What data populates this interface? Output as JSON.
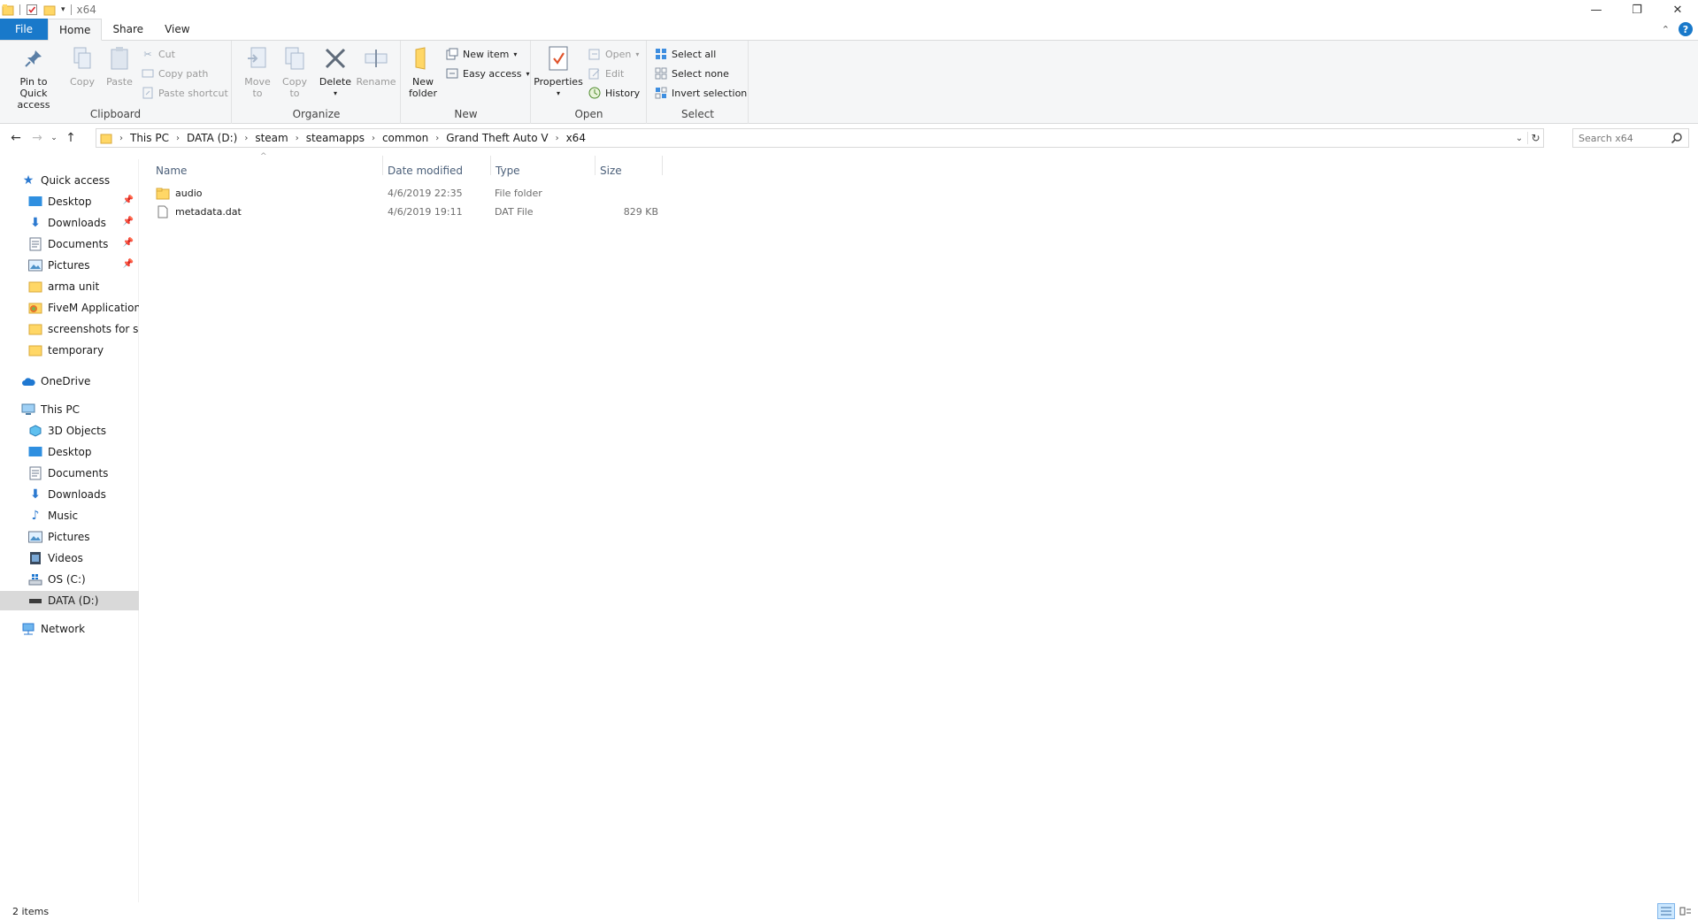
{
  "window": {
    "title": "x64",
    "controls": {
      "minimize": "—",
      "maximize": "❐",
      "close": "✕"
    }
  },
  "ribbon_tabs": [
    {
      "label": "File"
    },
    {
      "label": "Home"
    },
    {
      "label": "Share"
    },
    {
      "label": "View"
    }
  ],
  "ribbon": {
    "clipboard": {
      "label": "Clipboard",
      "pin": "Pin to Quick access",
      "copy": "Copy",
      "paste": "Paste",
      "cut": "Cut",
      "copy_path": "Copy path",
      "paste_shortcut": "Paste shortcut"
    },
    "organize": {
      "label": "Organize",
      "move_to": "Move to",
      "copy_to": "Copy to",
      "delete": "Delete",
      "rename": "Rename"
    },
    "new": {
      "label": "New",
      "new_folder": "New folder",
      "new_item": "New item",
      "easy_access": "Easy access"
    },
    "open": {
      "label": "Open",
      "properties": "Properties",
      "open": "Open",
      "edit": "Edit",
      "history": "History"
    },
    "select": {
      "label": "Select",
      "select_all": "Select all",
      "select_none": "Select none",
      "invert": "Invert selection"
    }
  },
  "address": {
    "breadcrumbs": [
      "This PC",
      "DATA (D:)",
      "steam",
      "steamapps",
      "common",
      "Grand Theft Auto V",
      "x64"
    ],
    "search_placeholder": "Search x64"
  },
  "nav": {
    "quick_access": "Quick access",
    "quick_items": [
      "Desktop",
      "Downloads",
      "Documents",
      "Pictures",
      "arma unit",
      "FiveM Application Data",
      "screenshots for support",
      "temporary"
    ],
    "onedrive": "OneDrive",
    "this_pc": "This PC",
    "pc_items": [
      "3D Objects",
      "Desktop",
      "Documents",
      "Downloads",
      "Music",
      "Pictures",
      "Videos",
      "OS (C:)",
      "DATA (D:)"
    ],
    "network": "Network"
  },
  "columns": [
    "Name",
    "Date modified",
    "Type",
    "Size"
  ],
  "files": [
    {
      "name": "audio",
      "date": "4/6/2019 22:35",
      "type": "File folder",
      "size": ""
    },
    {
      "name": "metadata.dat",
      "date": "4/6/2019 19:11",
      "type": "DAT File",
      "size": "829 KB"
    }
  ],
  "status": {
    "count": "2 items"
  },
  "colors": {
    "accent": "#1979ca",
    "folder": "#ffd766",
    "selected": "#d9d9d9"
  }
}
